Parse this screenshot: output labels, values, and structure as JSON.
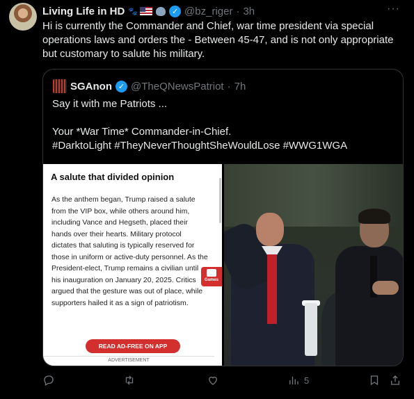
{
  "tweet": {
    "author_name": "Living Life in HD",
    "handle": "@bz_riger",
    "separator": "·",
    "time": "3h",
    "more": "···",
    "text": "Hi is currently the Commander and Chief, war time president via special operations laws and orders the - Between 45-47, and is not only appropriate but customary to salute his military."
  },
  "quote": {
    "author_name": "SGAnon",
    "handle": "@TheQNewsPatriot",
    "separator": "·",
    "time": "7h",
    "line1": "Say it with me Patriots ...",
    "line2": "Your *War Time* Commander-in-Chief.",
    "line3": "#DarktoLight #TheyNeverThoughtSheWouldLose #WWG1WGA",
    "article": {
      "title": "A salute that divided opinion",
      "body": "As the anthem began, Trump raised a salute from the VIP box, while others around him, including Vance and Hegseth, placed their hands over their hearts. Military protocol dictates that saluting is typically reserved for those in uniform or active-duty personnel. As the President-elect, Trump remains a civilian until his inauguration on January 20, 2025. Critics argued that the gesture was out of place, while supporters hailed it as a sign of patriotism.",
      "games_label": "Games",
      "button": "READ AD-FREE ON APP",
      "ad_label": "ADVERTISEMENT"
    }
  },
  "actions": {
    "views": "5"
  },
  "colors": {
    "background": "#000000",
    "text": "#e7e9ea",
    "muted": "#71767b",
    "verified": "#1d9bf0",
    "ad_red": "#d32f2f"
  }
}
